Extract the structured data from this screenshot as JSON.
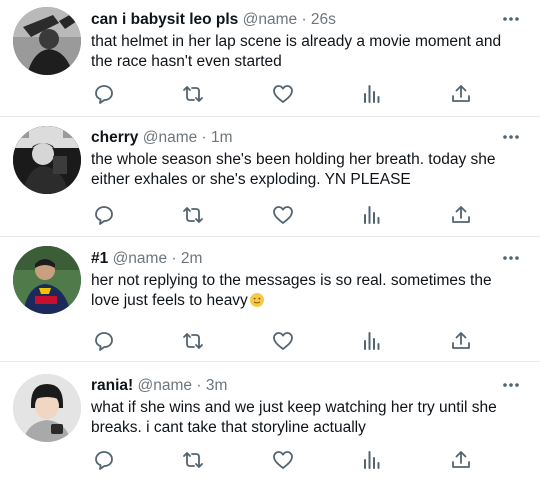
{
  "tweets": [
    {
      "display_name": "can i babysit leo pls",
      "handle": "@name",
      "time": "26s",
      "text": "that helmet in her lap scene is already a movie moment and the race hasn't even started"
    },
    {
      "display_name": "cherry",
      "handle": "@name",
      "time": "1m",
      "text": "the whole season she's been holding her breath. today she either exhales or she's exploding. YN PLEASE"
    },
    {
      "display_name": "#1",
      "handle": "@name",
      "time": "2m",
      "text": "her not replying to the messages is so real. sometimes the love just feels to heavy"
    },
    {
      "display_name": "rania!",
      "handle": "@name",
      "time": "3m",
      "text": "what if she wins and we just keep watching her try until she breaks. i cant take that storyline actually"
    }
  ],
  "separator": "·",
  "icons": {
    "more": "more-horizontal-icon",
    "reply": "reply-icon",
    "retweet": "retweet-icon",
    "like": "heart-icon",
    "views": "views-chart-icon",
    "share": "share-icon",
    "emoji": "slightly-smiling-face-emoji"
  },
  "colors": {
    "name": "#0f1419",
    "meta": "#6e767d",
    "icon": "#536471",
    "divider": "#e6e8ea"
  }
}
